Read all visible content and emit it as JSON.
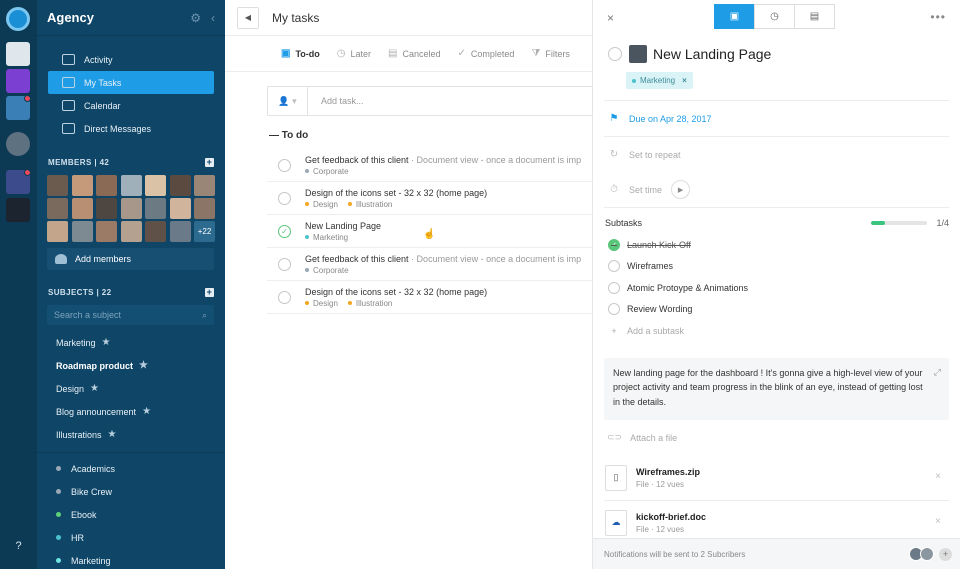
{
  "sidebar": {
    "title": "Agency",
    "nav": [
      {
        "label": "Activity",
        "icon": "activity-icon"
      },
      {
        "label": "My Tasks",
        "icon": "list-icon",
        "active": true
      },
      {
        "label": "Calendar",
        "icon": "calendar-icon"
      },
      {
        "label": "Direct Messages",
        "icon": "messages-icon"
      }
    ],
    "members_header": "MEMBERS | 42",
    "members_more": "+22",
    "add_members": "Add members",
    "subjects_header": "SUBJECTS | 22",
    "search_placeholder": "Search a subject",
    "subjects": [
      {
        "label": "Marketing",
        "bold": false
      },
      {
        "label": "Roadmap product",
        "bold": true
      },
      {
        "label": "Design",
        "bold": false
      },
      {
        "label": "Blog announcement",
        "bold": false
      },
      {
        "label": "Illustrations",
        "bold": false
      }
    ],
    "projects": [
      {
        "label": "Academics",
        "color": "#9aa9b5"
      },
      {
        "label": "Bike Crew",
        "color": "#9aa9b5"
      },
      {
        "label": "Ebook",
        "color": "#5fd07a"
      },
      {
        "label": "HR",
        "color": "#4ac3cf"
      },
      {
        "label": "Marketing",
        "color": "#6ee3e0"
      }
    ],
    "help": "?"
  },
  "main": {
    "title": "My tasks",
    "tabs": [
      "To-do",
      "Later",
      "Canceled",
      "Completed",
      "Filters"
    ],
    "add_task_placeholder": "Add task...",
    "group_title": "— To do",
    "tasks": [
      {
        "name": "Get feedback of this client",
        "desc": " · Document view - once a document is imp",
        "tags": [
          {
            "label": "Corporate",
            "color": "#9aa9b5"
          }
        ]
      },
      {
        "name": "Design of the icons set - 32 x 32 (home page)",
        "desc": "",
        "tags": [
          {
            "label": "Design",
            "color": "#f5a623"
          },
          {
            "label": "Illustration",
            "color": "#f5a623"
          }
        ]
      },
      {
        "name": "New Landing Page",
        "desc": "",
        "done": true,
        "tags": [
          {
            "label": "Marketing",
            "color": "#4ac3cf"
          }
        ]
      },
      {
        "name": "Get feedback of this client",
        "desc": " · Document view - once a document is imp",
        "tags": [
          {
            "label": "Corporate",
            "color": "#9aa9b5"
          }
        ]
      },
      {
        "name": "Design of the icons set - 32 x 32 (home page)",
        "desc": "",
        "tags": [
          {
            "label": "Design",
            "color": "#f5a623"
          },
          {
            "label": "Illustration",
            "color": "#f5a623"
          }
        ]
      }
    ]
  },
  "detail": {
    "close": "×",
    "more": "•••",
    "title": "New Landing Page",
    "tag": "Marketing",
    "tag_remove": "×",
    "due": "Due on Apr 28, 2017",
    "repeat": "Set to repeat",
    "time": "Set time",
    "subtasks_label": "Subtasks",
    "subtasks_count": "1/4",
    "subtasks_progress": 0.25,
    "subtasks": [
      {
        "label": "Launch Kick-Off",
        "done": true
      },
      {
        "label": "Wireframes",
        "done": false
      },
      {
        "label": "Atomic Protoype & Animations",
        "done": false
      },
      {
        "label": "Review Wording",
        "done": false
      }
    ],
    "add_subtask": "Add a subtask",
    "description": "New landing page for the dashboard ! It's gonna give a high-level view of your project activity and team progress in the blink of an eye, instead of getting lost in the details.",
    "attach": "Attach a file",
    "files": [
      {
        "name": "Wireframes.zip",
        "meta": "File · 12 vues",
        "icon": "zip-icon"
      },
      {
        "name": "kickoff-brief.doc",
        "meta": "File · 12 vues",
        "icon": "cloud-icon"
      }
    ],
    "footer": "Notifications will be sent to 2 Subcribers"
  },
  "colors": {
    "accent": "#1e9ce6",
    "sidebar": "#0f4566",
    "rail": "#0c3a55",
    "success": "#59c679"
  }
}
